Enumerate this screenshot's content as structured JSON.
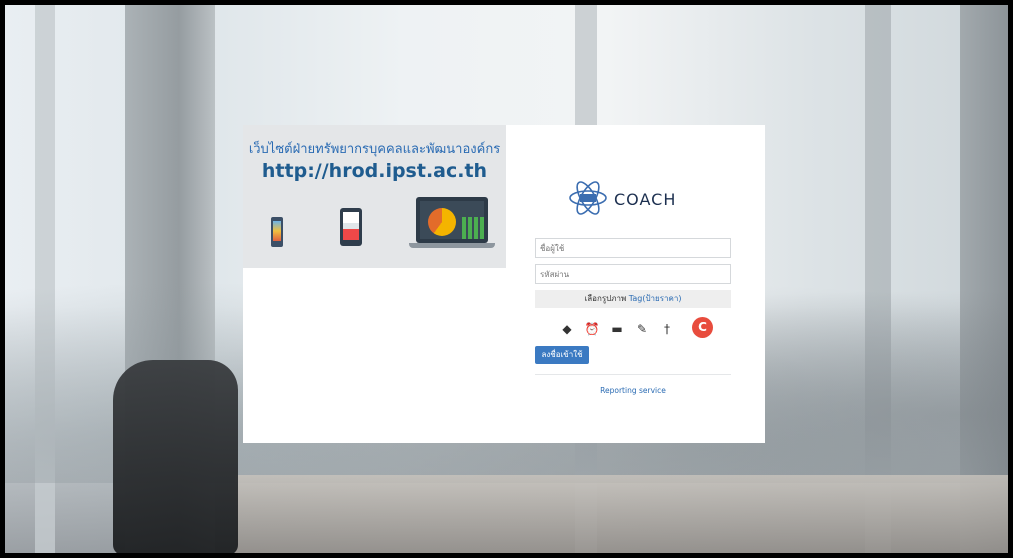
{
  "banner": {
    "title": "เว็บไซต์ฝ่ายทรัพยากรบุคคลและพัฒนาองค์กร",
    "url": "http://hrod.ipst.ac.th"
  },
  "logo": {
    "text": "COACH"
  },
  "login": {
    "username_placeholder": "ชื่อผู้ใช้",
    "password_placeholder": "รหัสผ่าน",
    "group_prefix": "เลือกรูปภาพ",
    "group_tag": "Tag(ป้ายราคา)",
    "login_label": "ลงชื่อเข้าใช้",
    "reporting_label": "Reporting service"
  },
  "captcha_icons": [
    {
      "name": "tag-icon",
      "glyph": "◆"
    },
    {
      "name": "alarm-clock-icon",
      "glyph": "⏰"
    },
    {
      "name": "truck-icon",
      "glyph": "▬"
    },
    {
      "name": "pencil-icon",
      "glyph": "✎"
    },
    {
      "name": "pin-icon",
      "glyph": "†"
    }
  ],
  "refresh_icon": {
    "name": "refresh-icon",
    "glyph": "C"
  },
  "colors": {
    "accent": "#2a6bb3",
    "button": "#3b7ac2",
    "refresh": "#e84c3d"
  }
}
